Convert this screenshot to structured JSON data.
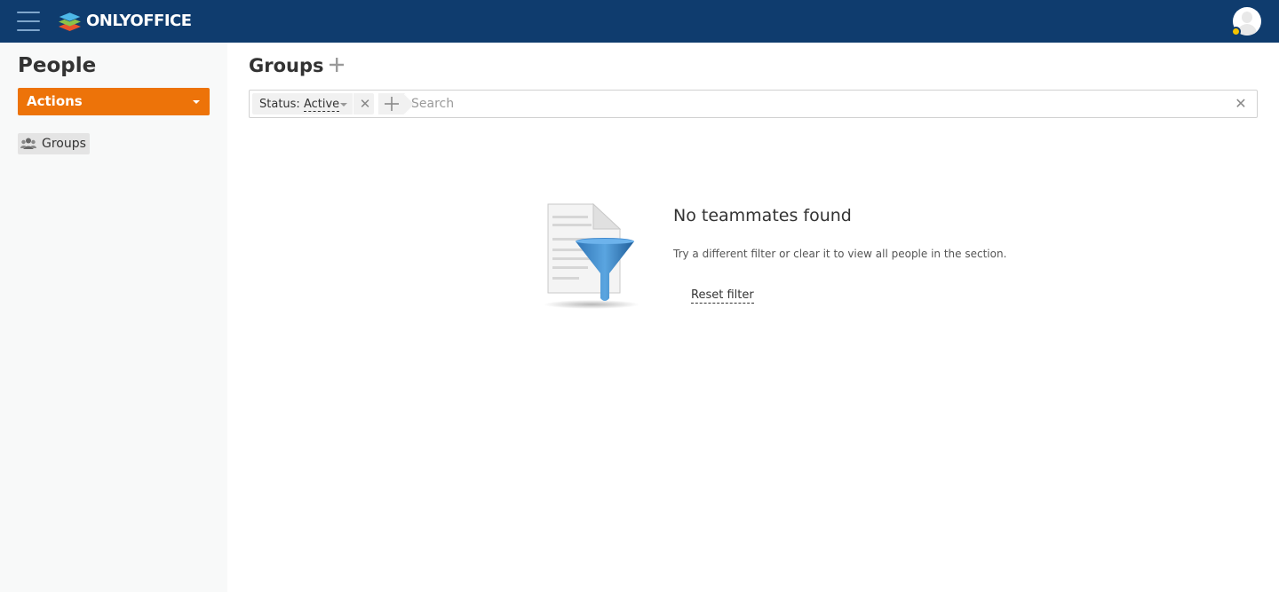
{
  "header": {
    "logo_text": "ONLYOFFICE",
    "menu_icon": "hamburger-icon",
    "avatar_icon": "user-avatar-icon",
    "status_color": "#f5c400",
    "background_color": "#0f3c6e"
  },
  "sidebar": {
    "title": "People",
    "actions_label": "Actions",
    "actions_color": "#ed7309",
    "items": [
      {
        "label": "Groups",
        "icon": "people-group-icon",
        "selected": true
      }
    ]
  },
  "main": {
    "title": "Groups",
    "add_icon": "plus-icon",
    "filter": {
      "chip_label": "Status:",
      "chip_value": "Active",
      "chip_remove_glyph": "✕",
      "add_filter_icon": "plus-icon",
      "search_placeholder": "Search",
      "search_value": "",
      "clear_glyph": "✕"
    },
    "empty_state": {
      "illustration": "document-funnel-icon",
      "title": "No teammates found",
      "description": "Try a different filter or clear it to view all people in the section.",
      "reset_label": "Reset filter"
    }
  }
}
